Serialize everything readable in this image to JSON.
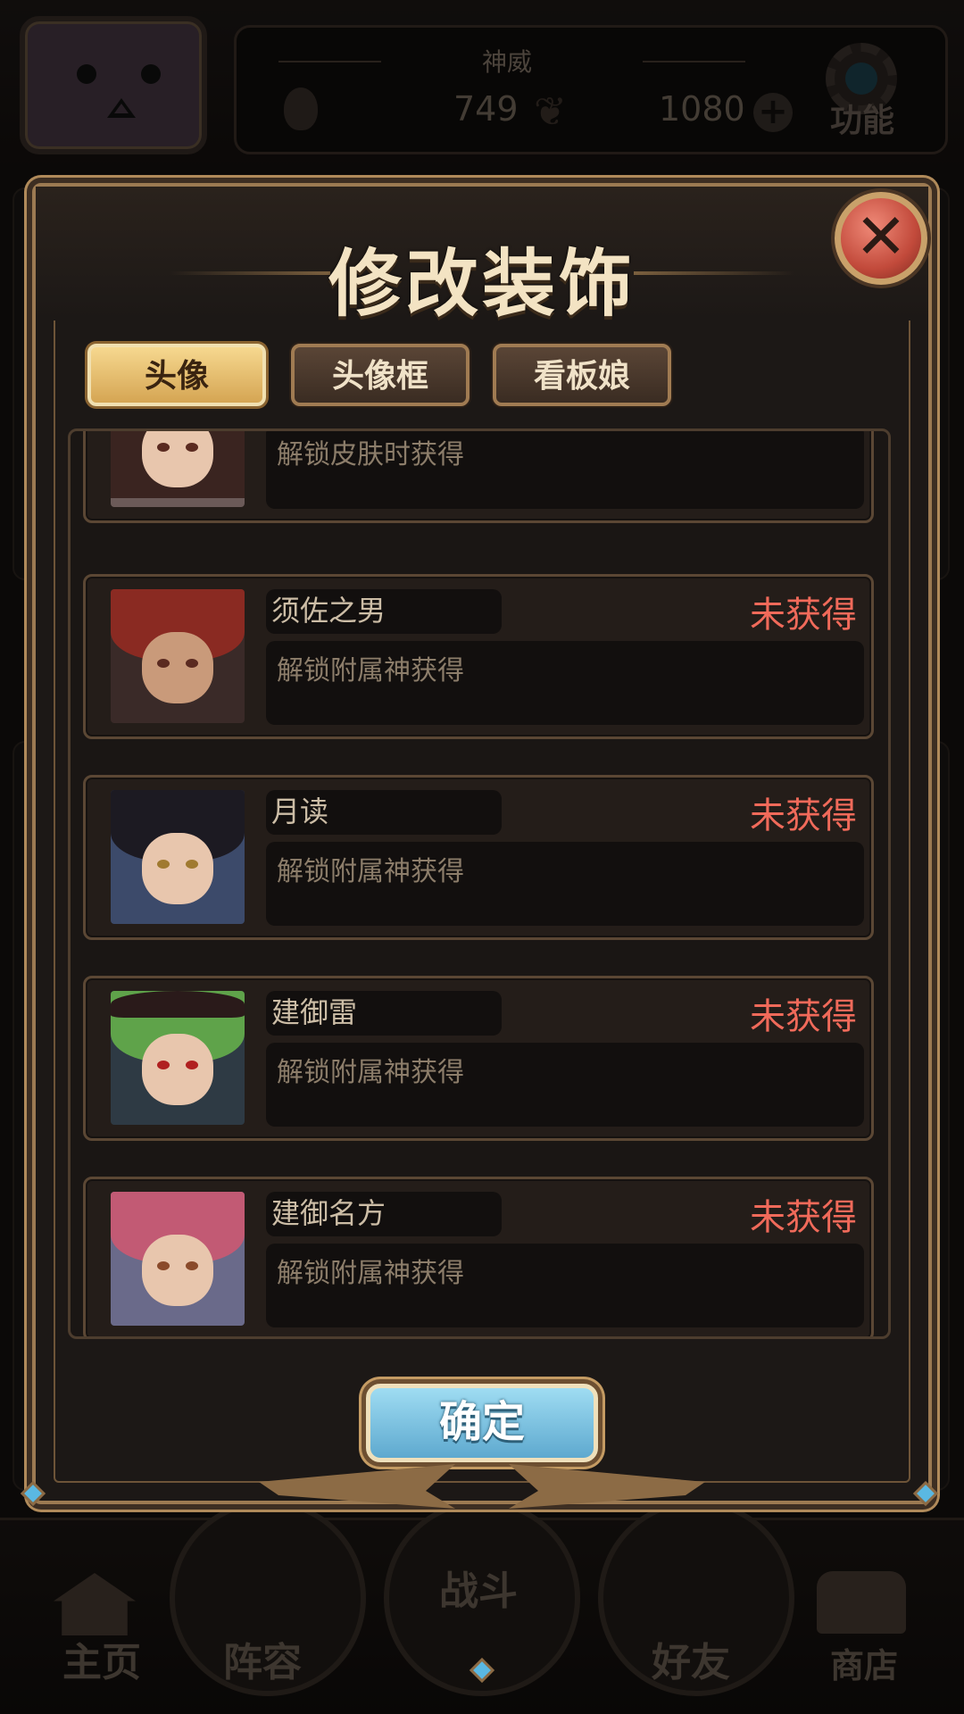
{
  "hud": {
    "player_name": "神威",
    "stamina": "749",
    "gems": "1080",
    "function_label": "功能"
  },
  "background": {
    "name_ghost": "神威"
  },
  "modal": {
    "title": "修改装饰",
    "tabs": [
      {
        "label": "头像",
        "active": true
      },
      {
        "label": "头像框",
        "active": false
      },
      {
        "label": "看板娘",
        "active": false
      }
    ],
    "items": [
      {
        "name": "",
        "status": "",
        "desc": "解锁皮肤时获得",
        "portrait": "long dark hair girl with checkered sleeve",
        "partial": true
      },
      {
        "name": "须佐之男",
        "status": "未获得",
        "desc": "解锁附属神获得",
        "portrait": "red haired man"
      },
      {
        "name": "月读",
        "status": "未获得",
        "desc": "解锁附属神获得",
        "portrait": "black haired girl"
      },
      {
        "name": "建御雷",
        "status": "未获得",
        "desc": "解锁附属神获得",
        "portrait": "green haired girl with cap"
      },
      {
        "name": "建御名方",
        "status": "未获得",
        "desc": "解锁附属神获得",
        "portrait": "pink haired girl"
      }
    ],
    "confirm_label": "确定",
    "close_icon": "close-icon"
  },
  "nav": {
    "items": [
      "主页",
      "阵容",
      "战斗",
      "好友",
      "商店"
    ]
  },
  "colors": {
    "status_red": "#f06a5a",
    "tab_active": "#e6bd6c",
    "confirm_blue": "#7cc4e3",
    "close_red": "#d45a48"
  }
}
